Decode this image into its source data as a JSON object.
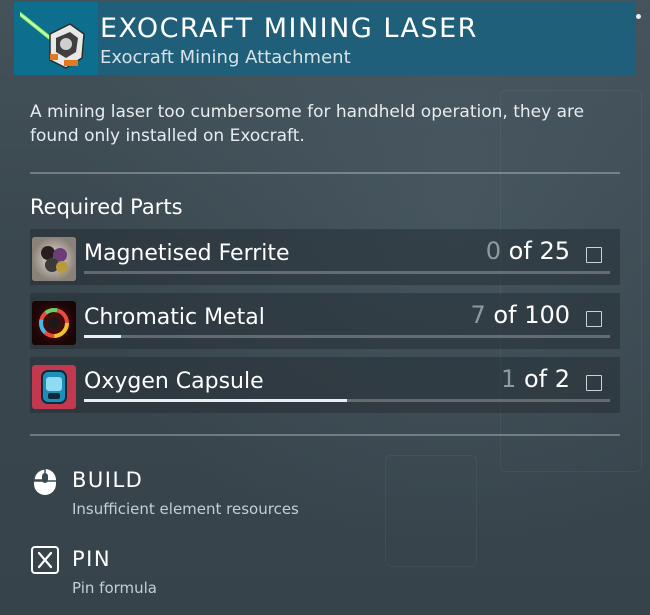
{
  "header": {
    "title": "EXOCRAFT MINING LASER",
    "subtitle": "Exocraft Mining Attachment",
    "icon": "mining-laser-icon"
  },
  "description": "A mining laser too cumbersome for handheld operation, they are found only installed on Exocraft.",
  "required_parts": {
    "heading": "Required Parts",
    "items": [
      {
        "name": "Magnetised Ferrite",
        "have": "0",
        "of_label": "of",
        "need": "25",
        "progress": 0.0,
        "icon": "magnetised-ferrite-icon",
        "checked": false
      },
      {
        "name": "Chromatic Metal",
        "have": "7",
        "of_label": "of",
        "need": "100",
        "progress": 0.07,
        "icon": "chromatic-metal-icon",
        "checked": false
      },
      {
        "name": "Oxygen Capsule",
        "have": "1",
        "of_label": "of",
        "need": "2",
        "progress": 0.5,
        "icon": "oxygen-capsule-icon",
        "checked": false
      }
    ]
  },
  "actions": {
    "build": {
      "label": "BUILD",
      "hint": "Insufficient element resources",
      "icon": "mouse-icon"
    },
    "pin": {
      "label": "PIN",
      "hint": "Pin formula",
      "icon": "x-key-icon"
    }
  },
  "colors": {
    "header_bg": "#1f5f79",
    "header_icon_bg": "#0e6e8e",
    "panel_bg": "#3d4a52",
    "count_have": "#8f9aa0"
  }
}
